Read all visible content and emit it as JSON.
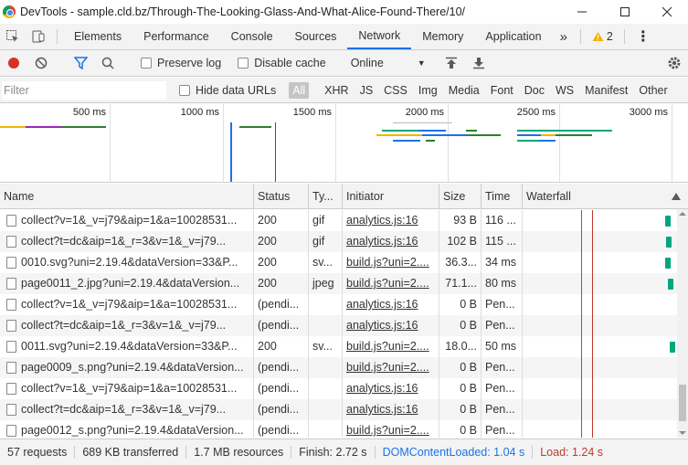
{
  "window": {
    "title": "DevTools - sample.cld.bz/Through-The-Looking-Glass-And-What-Alice-Found-There/10/",
    "controls": [
      "minimize",
      "maximize",
      "close"
    ]
  },
  "tabs": {
    "items": [
      "Elements",
      "Performance",
      "Console",
      "Sources",
      "Network",
      "Memory",
      "Application"
    ],
    "active": "Network",
    "more": "»",
    "warning_count": "2",
    "menu": "⋮"
  },
  "toolbar": {
    "preserve_log": "Preserve log",
    "disable_cache": "Disable cache",
    "throttling": "Online",
    "throttling_arrow": "▼"
  },
  "filter": {
    "placeholder": "Filter",
    "hide_data_urls": "Hide data URLs",
    "types": [
      "All",
      "XHR",
      "JS",
      "CSS",
      "Img",
      "Media",
      "Font",
      "Doc",
      "WS",
      "Manifest",
      "Other"
    ]
  },
  "overview": {
    "tick_labels": [
      "500 ms",
      "1000 ms",
      "1500 ms",
      "2000 ms",
      "2500 ms",
      "3000 ms"
    ]
  },
  "table": {
    "headers": {
      "name": "Name",
      "status": "Status",
      "type": "Ty...",
      "initiator": "Initiator",
      "size": "Size",
      "time": "Time",
      "waterfall": "Waterfall"
    },
    "rows": [
      {
        "name": "collect?v=1&_v=j79&aip=1&a=10028531...",
        "status": "200",
        "type": "gif",
        "initiator": "analytics.js:16",
        "size": "93 B",
        "time": "116 ..."
      },
      {
        "name": "collect?t=dc&aip=1&_r=3&v=1&_v=j79...",
        "status": "200",
        "type": "gif",
        "initiator": "analytics.js:16",
        "size": "102 B",
        "time": "115 ..."
      },
      {
        "name": "0010.svg?uni=2.19.4&dataVersion=33&P...",
        "status": "200",
        "type": "sv...",
        "initiator": "build.js?uni=2....",
        "size": "36.3...",
        "time": "34 ms"
      },
      {
        "name": "page0011_2.jpg?uni=2.19.4&dataVersion...",
        "status": "200",
        "type": "jpeg",
        "initiator": "build.js?uni=2....",
        "size": "71.1...",
        "time": "80 ms"
      },
      {
        "name": "collect?v=1&_v=j79&aip=1&a=10028531...",
        "status": "(pendi...",
        "type": "",
        "initiator": "analytics.js:16",
        "size": "0 B",
        "time": "Pen..."
      },
      {
        "name": "collect?t=dc&aip=1&_r=3&v=1&_v=j79...",
        "status": "(pendi...",
        "type": "",
        "initiator": "analytics.js:16",
        "size": "0 B",
        "time": "Pen..."
      },
      {
        "name": "0011.svg?uni=2.19.4&dataVersion=33&P...",
        "status": "200",
        "type": "sv...",
        "initiator": "build.js?uni=2....",
        "size": "18.0...",
        "time": "50 ms"
      },
      {
        "name": "page0009_s.png?uni=2.19.4&dataVersion...",
        "status": "(pendi...",
        "type": "",
        "initiator": "build.js?uni=2....",
        "size": "0 B",
        "time": "Pen..."
      },
      {
        "name": "collect?v=1&_v=j79&aip=1&a=10028531...",
        "status": "(pendi...",
        "type": "",
        "initiator": "analytics.js:16",
        "size": "0 B",
        "time": "Pen..."
      },
      {
        "name": "collect?t=dc&aip=1&_r=3&v=1&_v=j79...",
        "status": "(pendi...",
        "type": "",
        "initiator": "analytics.js:16",
        "size": "0 B",
        "time": "Pen..."
      },
      {
        "name": "page0012_s.png?uni=2.19.4&dataVersion...",
        "status": "(pendi...",
        "type": "",
        "initiator": "build.js?uni=2....",
        "size": "0 B",
        "time": "Pen..."
      }
    ]
  },
  "status": {
    "requests": "57 requests",
    "transferred": "689 KB transferred",
    "resources": "1.7 MB resources",
    "finish": "Finish: 2.72 s",
    "dom_content_loaded": "DOMContentLoaded: 1.04 s",
    "load": "Load: 1.24 s"
  },
  "colors": {
    "accent": "#1a73e8",
    "record": "#d93025",
    "dcl_line": "#1a73e8",
    "load_line": "#c0392b",
    "waterfall_bar": "#00a67e",
    "warning": "#f4b400"
  }
}
